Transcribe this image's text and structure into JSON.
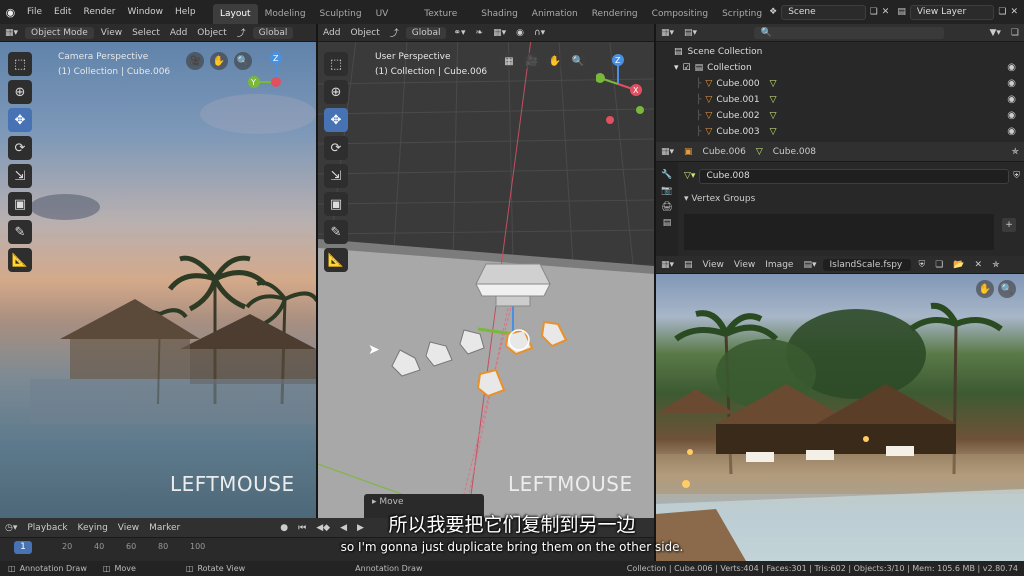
{
  "menu": {
    "file": "File",
    "edit": "Edit",
    "render": "Render",
    "window": "Window",
    "help": "Help"
  },
  "workspaces": [
    "Layout",
    "Modeling",
    "Sculpting",
    "UV Editing",
    "Texture Paint",
    "Shading",
    "Animation",
    "Rendering",
    "Compositing",
    "Scripting"
  ],
  "scene": {
    "name": "Scene",
    "view_layer": "View Layer"
  },
  "left_viewport": {
    "mode": "Object Mode",
    "view": "View",
    "select": "Select",
    "add": "Add",
    "object": "Object",
    "orientation": "Global",
    "label1": "Camera Perspective",
    "label2": "(1) Collection | Cube.006",
    "overlay_text": "LEFTMOUSE"
  },
  "center_viewport": {
    "add": "Add",
    "object": "Object",
    "orientation": "Global",
    "label1": "User Perspective",
    "label2": "(1) Collection | Cube.006",
    "overlay_text": "LEFTMOUSE",
    "operator_panel": "Move"
  },
  "gizmo": {
    "x": "X",
    "y": "Y",
    "z": "Z"
  },
  "outliner": {
    "scene_collection": "Scene Collection",
    "collection": "Collection",
    "items": [
      "Cube.000",
      "Cube.001",
      "Cube.002",
      "Cube.003"
    ]
  },
  "properties": {
    "object": "Cube.006",
    "mesh": "Cube.008",
    "data_name": "Cube.008",
    "panel": "Vertex Groups"
  },
  "image_editor": {
    "view": "View",
    "view2": "View",
    "image": "Image",
    "file": "IslandScale.fspy"
  },
  "timeline": {
    "playback": "Playback",
    "keying": "Keying",
    "view": "View",
    "marker": "Marker",
    "frame": "1",
    "ticks": [
      "20",
      "40",
      "60",
      "80",
      "100"
    ]
  },
  "subtitles": {
    "zh": "所以我要把它们复制到另一边",
    "en": "so I'm gonna just duplicate bring them on the other side."
  },
  "status": {
    "annotation1": "Annotation Draw",
    "move": "Move",
    "rotate": "Rotate View",
    "annotation2": "Annotation Draw",
    "info": "Collection | Cube.006 | Verts:404 | Faces:301 | Tris:602 | Objects:3/10 | Mem: 105.6 MB | v2.80.74"
  },
  "colors": {
    "accent": "#4772b3",
    "select_orange": "#e8902a",
    "x_axis": "#e05060",
    "y_axis": "#7ab83a",
    "z_axis": "#4a90e0"
  }
}
